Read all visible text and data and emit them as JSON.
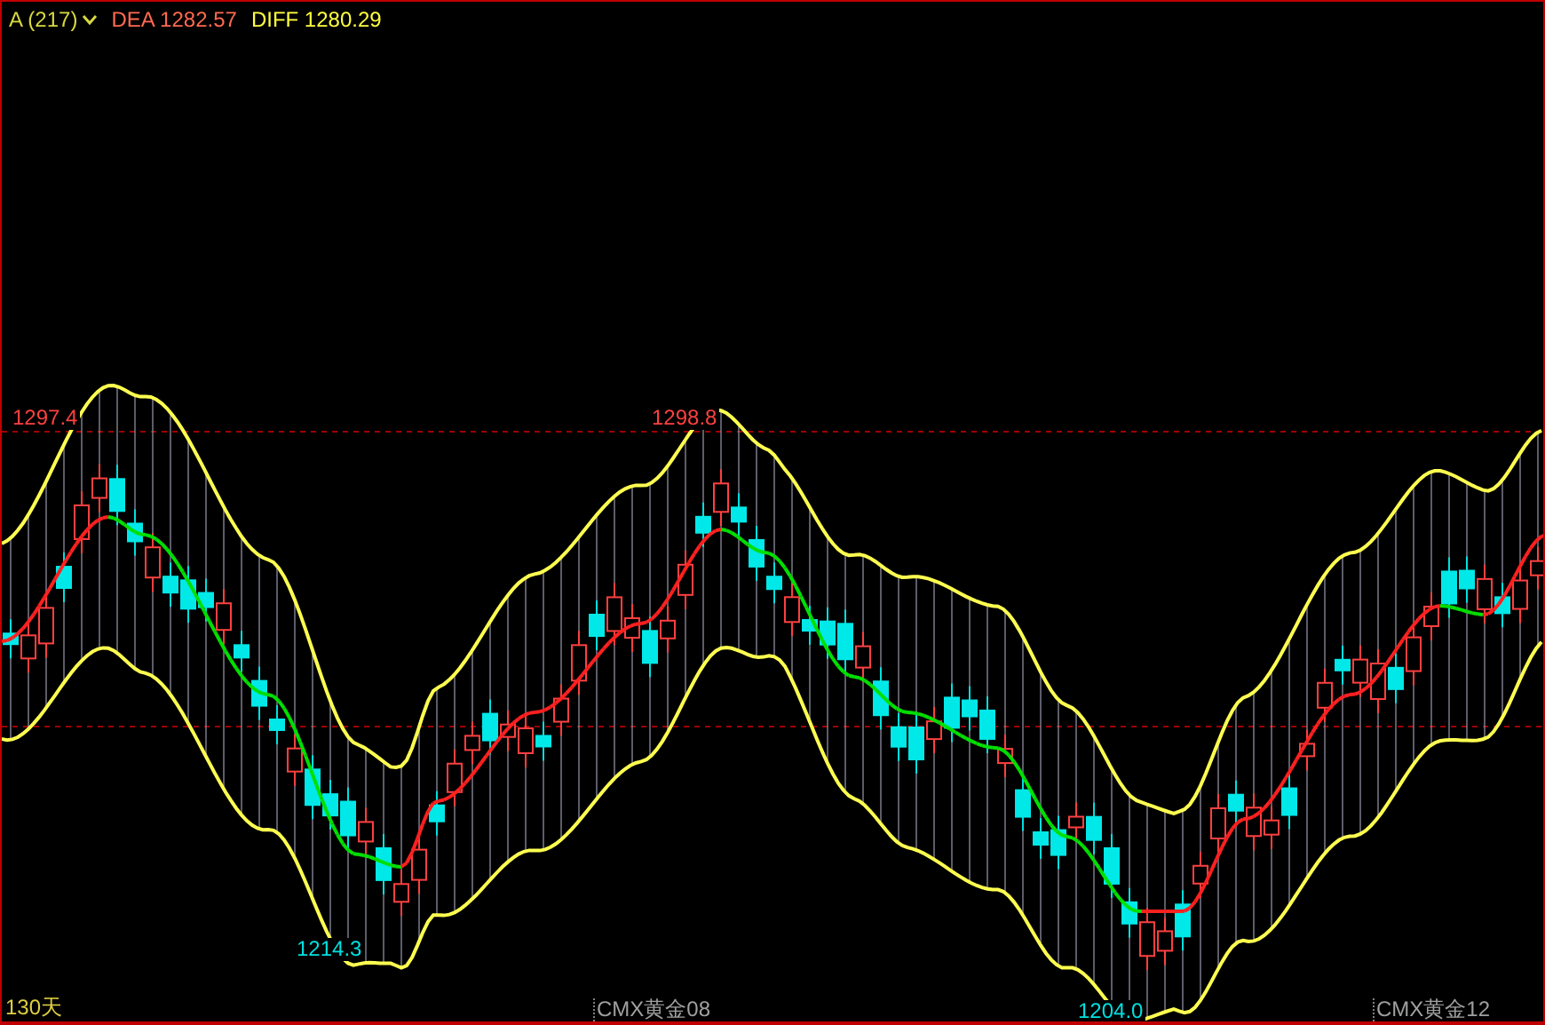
{
  "header": {
    "selector": "A (217)",
    "dea": "DEA 1282.57",
    "diff": "DIFF 1280.29"
  },
  "price_labels": [
    {
      "text": "1297.4",
      "kind": "high"
    },
    {
      "text": "1298.8",
      "kind": "high"
    },
    {
      "text": "1214.3",
      "kind": "low"
    },
    {
      "text": "1204.0",
      "kind": "low"
    }
  ],
  "period": "130天",
  "contracts": [
    "CMX黄金08",
    "CMX黄金12"
  ]
}
